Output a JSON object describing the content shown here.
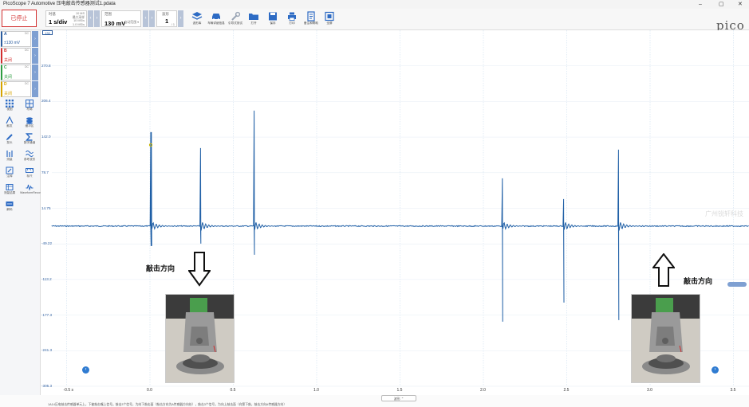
{
  "window": {
    "title": "PicoScope 7 Automotive 压电敲击传感器测试1.pdata",
    "controls": [
      "–",
      "▢",
      "✕"
    ]
  },
  "toolbar": {
    "stop_label": "已停止",
    "timebase": {
      "label": "时基",
      "value": "1 s/div",
      "notes": [
        "10 MS",
        "最大采样",
        "10 MS/s",
        "采样时间",
        "5 s",
        "1.0 MS/s"
      ]
    },
    "range": {
      "label": "范围",
      "value": "130 mV",
      "note": "自动范围 ▾"
    },
    "waveform_count": {
      "label": "波形",
      "value": "1",
      "note": "/ 1"
    },
    "tools": [
      {
        "label": "波形库",
        "icon": "layers-icon"
      },
      {
        "label": "车辆详细信息",
        "icon": "car-icon"
      },
      {
        "label": "引导式测试",
        "icon": "wrench-icon"
      },
      {
        "label": "打开",
        "icon": "folder-icon"
      },
      {
        "label": "保存",
        "icon": "save-icon"
      },
      {
        "label": "打印",
        "icon": "printer-icon"
      },
      {
        "label": "备注和帮助",
        "icon": "notes-icon"
      },
      {
        "label": "全屏",
        "icon": "fullscreen-icon"
      }
    ],
    "logo": "pico"
  },
  "channels": [
    {
      "name": "A",
      "coupling": "DC",
      "value": "±130 mV",
      "color": "#2c5d9f"
    },
    {
      "name": "B",
      "coupling": "DC",
      "value": "关闭",
      "color": "#d32f2f"
    },
    {
      "name": "C",
      "coupling": "DC",
      "value": "关闭",
      "color": "#2e9d41"
    },
    {
      "name": "D",
      "coupling": "DC",
      "value": "关闭",
      "color": "#d6a400"
    }
  ],
  "side_tools": [
    {
      "label": "视图",
      "icon": "grid-icon"
    },
    {
      "label": "布局",
      "icon": "layout-icon"
    },
    {
      "label": "触发",
      "icon": "trigger-icon"
    },
    {
      "label": "缓冲区",
      "icon": "stack-icon"
    },
    {
      "label": "探头",
      "icon": "probe-icon"
    },
    {
      "label": "数学通道",
      "icon": "sigma-icon"
    },
    {
      "label": "测量",
      "icon": "measure-icon"
    },
    {
      "label": "参考波形",
      "icon": "reference-icon"
    },
    {
      "label": "注释",
      "icon": "note-icon"
    },
    {
      "label": "标尺",
      "icon": "ruler-icon"
    },
    {
      "label": "测量结果",
      "icon": "results-icon"
    },
    {
      "label": "WaveformRecorder",
      "icon": "recorder-icon"
    },
    {
      "label": "解码",
      "icon": "decode-icon"
    }
  ],
  "scope": {
    "ruler_tab": "130",
    "y_unit": "mV",
    "y_labels": [
      "130.0",
      "270.8",
      "206.4",
      "142.0",
      "78.7",
      "14.75",
      "-49.22",
      "-113.2",
      "-177.3",
      "-241.3",
      "-305.3"
    ],
    "x_labels": [
      "-0.5 s",
      "0.0",
      "0.5",
      "1.0",
      "1.5",
      "2.0",
      "2.5",
      "3.0",
      "3.5"
    ],
    "trace_color": "#1f5fa6",
    "watermark": "广州锐轩科技"
  },
  "annotations": {
    "left_text": "敲击方向",
    "right_text": "敲击方向"
  },
  "footer": {
    "timeline_button": "波形 ⌃",
    "caption": "1A14压电敲击传感器单元上，下被敲击嘴上信号。敲击3个信号，为向下敲击面（敲击方向为A传感器方向处），敲击3个信号，为向上敲击面（向第下敲，敲击方向A传感器方向）"
  }
}
